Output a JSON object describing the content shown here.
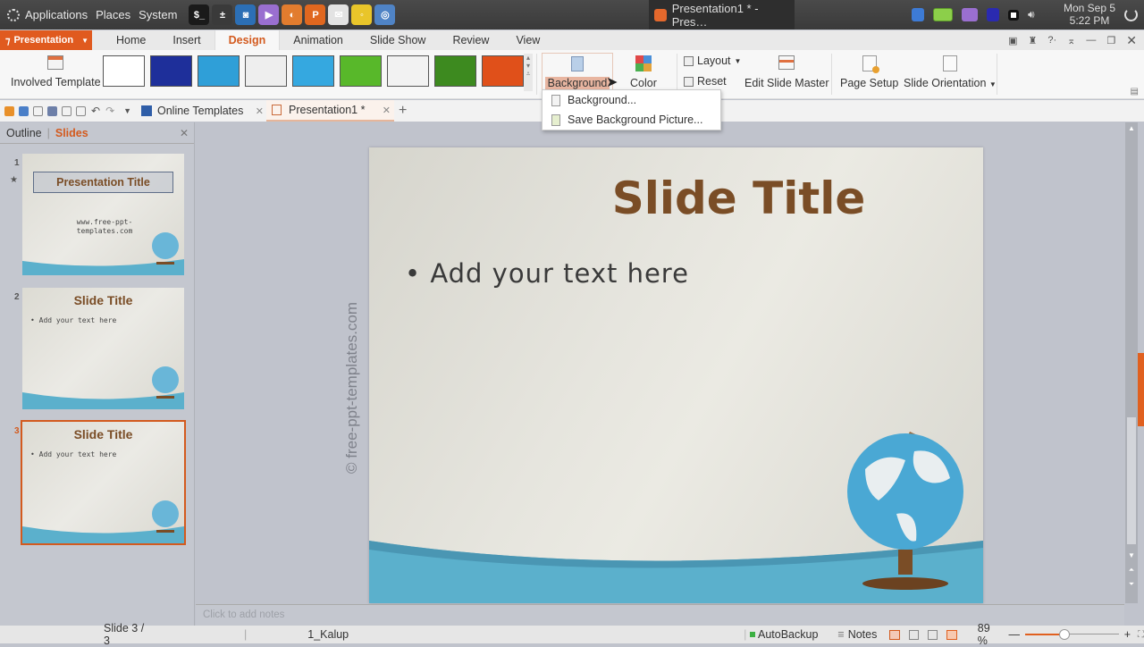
{
  "system_panel": {
    "menus": [
      "Applications",
      "Places",
      "System"
    ],
    "launchers": [
      {
        "name": "terminal",
        "color": "#1a1a1a",
        "glyph": "$_"
      },
      {
        "name": "calculator",
        "color": "#3a3a3a",
        "glyph": "±"
      },
      {
        "name": "camera",
        "color": "#2c6fb5",
        "glyph": "◙"
      },
      {
        "name": "video",
        "color": "#9a6fd0",
        "glyph": "▶"
      },
      {
        "name": "firefox",
        "color": "#e27c2e",
        "glyph": "◐"
      },
      {
        "name": "presentation",
        "color": "#e0671f",
        "glyph": "P"
      },
      {
        "name": "mail",
        "color": "#e3e3e3",
        "glyph": "✉"
      },
      {
        "name": "ideas",
        "color": "#e9c52a",
        "glyph": "◦"
      },
      {
        "name": "browser",
        "color": "#4f83c5",
        "glyph": "◎"
      }
    ],
    "task_title": "Presentation1 * - Pres…",
    "clock_date": "Mon Sep  5",
    "clock_time": "5:22 PM"
  },
  "app_menu": {
    "app_button": "Presentation",
    "tabs": [
      "Home",
      "Insert",
      "Design",
      "Animation",
      "Slide Show",
      "Review",
      "View"
    ],
    "active_tab": "Design"
  },
  "ribbon": {
    "involved_template": "Involved Template",
    "background": "Background",
    "color": "Color",
    "layout": "Layout",
    "reset": "Reset",
    "edit_slide_master": "Edit Slide Master",
    "page_setup": "Page Setup",
    "slide_orientation": "Slide Orientation",
    "templates": [
      {
        "bg": "#ffffff"
      },
      {
        "bg": "#1e2f9a"
      },
      {
        "bg": "#2f9fd8"
      },
      {
        "bg": "#eeeeee"
      },
      {
        "bg": "#35a8e0"
      },
      {
        "bg": "#58b82a"
      },
      {
        "bg": "#f2f2f2"
      },
      {
        "bg": "#3d8a1f"
      },
      {
        "bg": "#e0501a"
      }
    ]
  },
  "background_dropdown": {
    "items": [
      "Background...",
      "Save Background Picture..."
    ]
  },
  "doc_tabs": {
    "online_templates": "Online Templates",
    "presentation": "Presentation1 *"
  },
  "left_panel": {
    "tabs": [
      "Outline",
      "Slides"
    ],
    "active_tab": "Slides",
    "slides": [
      {
        "number": "1",
        "title": "Presentation Title",
        "subtitle": "www.free-ppt-templates.com"
      },
      {
        "number": "2",
        "title": "Slide Title",
        "bullet": "• Add your text here"
      },
      {
        "number": "3",
        "title": "Slide Title",
        "bullet": "• Add your text here",
        "selected": true
      }
    ]
  },
  "slide": {
    "title": "Slide Title",
    "bullet": "• Add your text here",
    "watermark": "© free-ppt-templates.com"
  },
  "notes": {
    "placeholder": "Click to add notes"
  },
  "status_bar": {
    "slide_counter": "Slide 3 / 3",
    "theme": "1_Kalup",
    "autobackup": "AutoBackup",
    "notes": "Notes",
    "zoom": "89 %",
    "zoom_fraction": 0.42
  },
  "colors": {
    "accent": "#d35a1e",
    "title_brown": "#7a4d26",
    "wave_blue": "#5bb0cc"
  }
}
